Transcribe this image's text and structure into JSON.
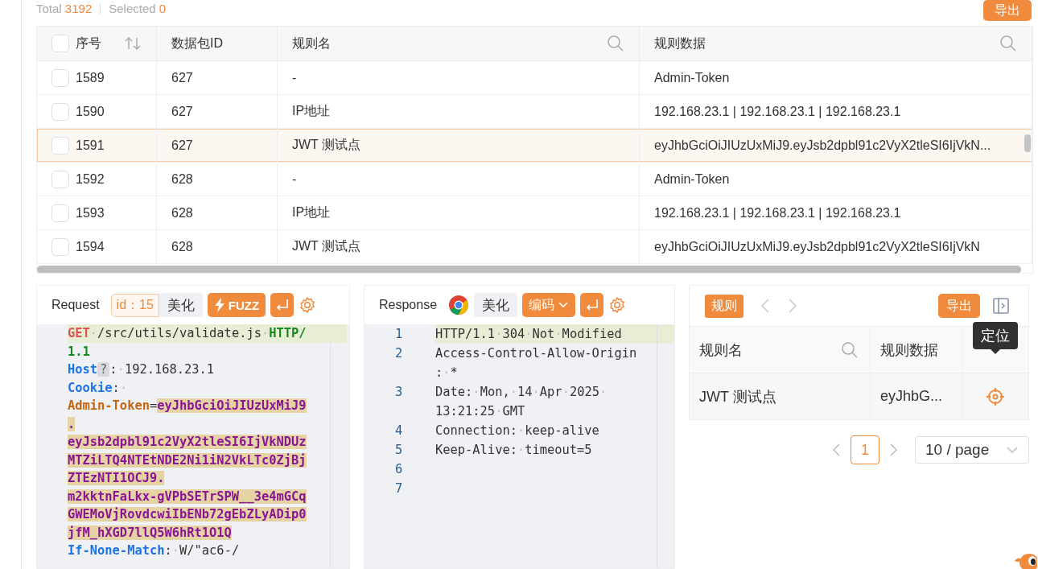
{
  "summary": {
    "total_label": "Total",
    "total": "3192",
    "selected_label": "Selected",
    "selected": "0"
  },
  "export_button": "导出",
  "table": {
    "select_all_checked": false,
    "columns": [
      {
        "label": "序号",
        "sortable": true,
        "searchable": false
      },
      {
        "label": "数据包ID",
        "sortable": false,
        "searchable": false
      },
      {
        "label": "规则名",
        "sortable": false,
        "searchable": true
      },
      {
        "label": "规则数据",
        "sortable": false,
        "searchable": true
      }
    ],
    "rows": [
      {
        "cells": [
          "1589",
          "627",
          "-",
          "Admin-Token"
        ],
        "checked": false,
        "selected": false
      },
      {
        "cells": [
          "1590",
          "627",
          "IP地址",
          "192.168.23.1 | 192.168.23.1 | 192.168.23.1"
        ],
        "checked": false,
        "selected": false
      },
      {
        "cells": [
          "1591",
          "627",
          "JWT 测试点",
          "eyJhbGciOiJIUzUxMiJ9.eyJsb2dpbl91c2VyX2tleSI6IjVkN..."
        ],
        "checked": false,
        "selected": true
      },
      {
        "cells": [
          "1592",
          "628",
          "-",
          "Admin-Token"
        ],
        "checked": false,
        "selected": false
      },
      {
        "cells": [
          "1593",
          "628",
          "IP地址",
          "192.168.23.1 | 192.168.23.1 | 192.168.23.1"
        ],
        "checked": false,
        "selected": false
      },
      {
        "cells": [
          "1594",
          "628",
          "JWT 测试点",
          "eyJhbGciOiJIUzUxMiJ9.eyJsb2dpbl91c2VyX2tleSI6IjVkN"
        ],
        "checked": false,
        "selected": false
      }
    ]
  },
  "request": {
    "title": "Request",
    "id_field": "id：15",
    "beautify": "美化",
    "fuzz": "FUZZ",
    "lines": [
      {
        "highlighted": true,
        "segments": [
          {
            "kind": "method",
            "text": "GET"
          },
          {
            "kind": "ws",
            "text": "·"
          },
          {
            "kind": "plain",
            "text": "/src/utils/validate.js"
          },
          {
            "kind": "ws",
            "text": "·"
          },
          {
            "kind": "version",
            "text": "HTTP/"
          }
        ]
      },
      {
        "highlighted": false,
        "segments": [
          {
            "kind": "version",
            "text": "1.1"
          }
        ]
      },
      {
        "highlighted": false,
        "segments": [
          {
            "kind": "key",
            "text": "Host"
          },
          {
            "kind": "badge",
            "text": "?"
          },
          {
            "kind": "plain",
            "text": ":"
          },
          {
            "kind": "ws",
            "text": "·"
          },
          {
            "kind": "plain",
            "text": "192.168.23.1"
          }
        ]
      },
      {
        "highlighted": false,
        "segments": [
          {
            "kind": "key",
            "text": "Cookie"
          },
          {
            "kind": "plain",
            "text": ":"
          },
          {
            "kind": "ws",
            "text": "·"
          }
        ]
      },
      {
        "highlighted": false,
        "segments": [
          {
            "kind": "cookie",
            "text": "Admin-Token"
          },
          {
            "kind": "plain",
            "text": "="
          },
          {
            "kind": "token",
            "text": "eyJhbGciOiJIUzUxMiJ9"
          }
        ]
      },
      {
        "highlighted": false,
        "segments": [
          {
            "kind": "token",
            "text": "."
          }
        ]
      },
      {
        "highlighted": false,
        "segments": [
          {
            "kind": "token",
            "text": "eyJsb2dpbl91c2VyX2tleSI6IjVkNDUz"
          }
        ]
      },
      {
        "highlighted": false,
        "segments": [
          {
            "kind": "token",
            "text": "MTZiLTQ4NTEtNDE2Ni1iN2VkLTc0ZjBj"
          }
        ]
      },
      {
        "highlighted": false,
        "segments": [
          {
            "kind": "token",
            "text": "ZTEzNTI1OCJ9."
          }
        ]
      },
      {
        "highlighted": false,
        "segments": [
          {
            "kind": "token",
            "text": "m2kktnFaLkx-gVPbSETrSPW__3e4mGCq"
          }
        ]
      },
      {
        "highlighted": false,
        "segments": [
          {
            "kind": "token",
            "text": "GWEMoVjRovdcwiIbENb72gEbZLyADip0"
          }
        ]
      },
      {
        "highlighted": false,
        "segments": [
          {
            "kind": "token",
            "text": "jfM_hXGD7llQ5W6hRt1O1Q"
          }
        ]
      },
      {
        "highlighted": false,
        "segments": [
          {
            "kind": "key",
            "text": "If-None-Match"
          },
          {
            "kind": "plain",
            "text": ":"
          },
          {
            "kind": "ws",
            "text": "·"
          },
          {
            "kind": "plain",
            "text": "W/\"ac6-/"
          }
        ]
      }
    ]
  },
  "response": {
    "title": "Response",
    "beautify": "美化",
    "encode": "编码",
    "lines": [
      {
        "number": "1",
        "highlighted": true,
        "wrapped_text": [
          "HTTP/1.1·304·Not·Modified"
        ]
      },
      {
        "number": "2",
        "highlighted": false,
        "wrapped_text": [
          "Access-Control-Allow-Origin",
          ":·*"
        ]
      },
      {
        "number": "3",
        "highlighted": false,
        "wrapped_text": [
          "Date:·Mon,·14·Apr·2025·",
          "13:21:25·GMT"
        ]
      },
      {
        "number": "4",
        "highlighted": false,
        "wrapped_text": [
          "Connection:·keep-alive"
        ]
      },
      {
        "number": "5",
        "highlighted": false,
        "wrapped_text": [
          "Keep-Alive:·timeout=5"
        ]
      },
      {
        "number": "6",
        "highlighted": false
      },
      {
        "number": "7",
        "highlighted": false
      }
    ]
  },
  "rules": {
    "tag": "规则",
    "export_button": "导出",
    "columns": [
      {
        "label": "规则名",
        "searchable": true
      },
      {
        "label": "规则数据",
        "searchable": false
      }
    ],
    "rows": [
      {
        "name": "JWT 测试点",
        "data": "eyJhbG..."
      }
    ],
    "tooltip": "定位",
    "pagination": {
      "pages": [
        {
          "label": "1",
          "selected": true
        }
      ],
      "page_size": "10 / page"
    }
  }
}
